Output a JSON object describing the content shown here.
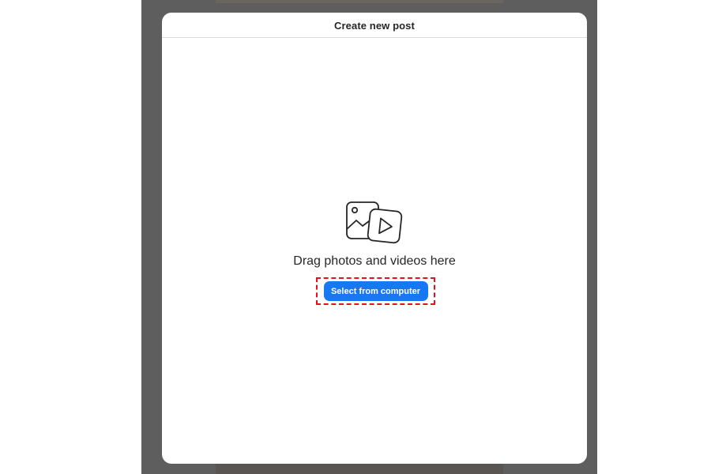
{
  "modal": {
    "title": "Create new post"
  },
  "upload": {
    "icon": "photo-video-icon",
    "prompt": "Drag photos and videos here",
    "button_label": "Select from computer"
  },
  "colors": {
    "button": "#1877f2",
    "highlight": "#e1121b",
    "backdrop": "#5e5e5e"
  }
}
